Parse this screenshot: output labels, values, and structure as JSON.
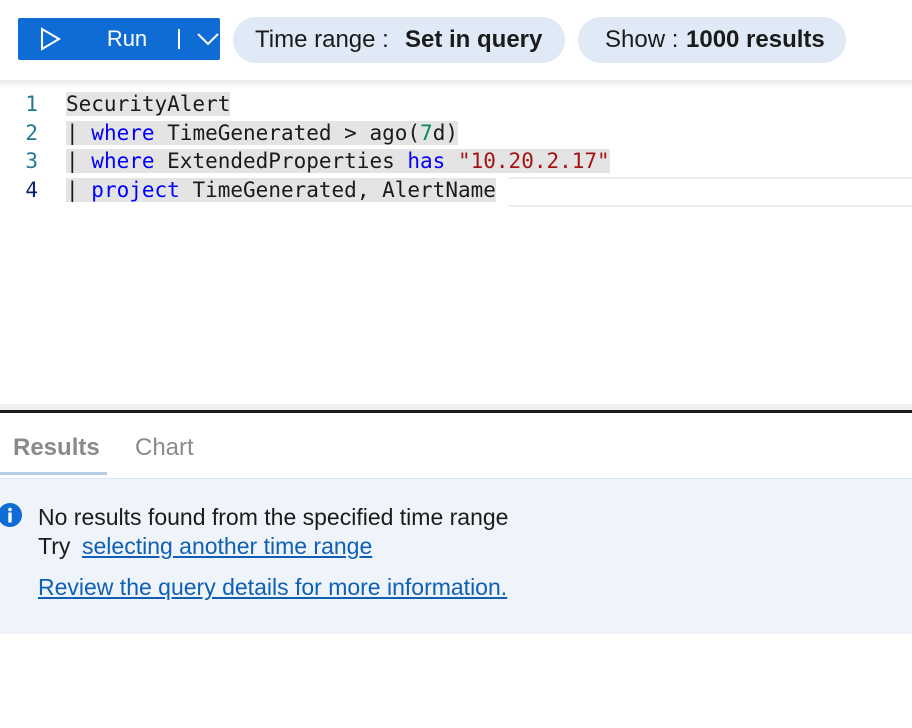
{
  "toolbar": {
    "run_label": "Run",
    "time_range_label": "Time range :",
    "time_range_value": "Set in query",
    "show_label": "Show :",
    "show_value": "1000 results"
  },
  "editor": {
    "lines": [
      {
        "number": "1",
        "text": "SecurityAlert"
      },
      {
        "number": "2",
        "pipe": "| ",
        "keyword": "where",
        "rest1": " TimeGenerated > ago(",
        "num": "7",
        "rest2": "d)"
      },
      {
        "number": "3",
        "pipe": "| ",
        "keyword": "where",
        "rest1": " ExtendedProperties ",
        "keyword2": "has",
        "space": " ",
        "string": "\"10.20.2.17\""
      },
      {
        "number": "4",
        "pipe": "| ",
        "keyword": "project",
        "rest1": " TimeGenerated, AlertName"
      }
    ]
  },
  "tabs": {
    "results": "Results",
    "chart": "Chart"
  },
  "message": {
    "title": "No results found from the specified time range",
    "try_text": "Try",
    "time_link": "selecting another time range",
    "details_link": "Review the query details for more information."
  },
  "colors": {
    "accent": "#0f6cd5",
    "pill_bg": "#dfeaf6",
    "keyword": "#0000ff",
    "string": "#a31515",
    "number": "#09885a",
    "link": "#0f5fb5",
    "info_bg": "#eef4fa"
  },
  "icons": [
    "play-icon",
    "chevron-down-icon",
    "info-icon"
  ]
}
